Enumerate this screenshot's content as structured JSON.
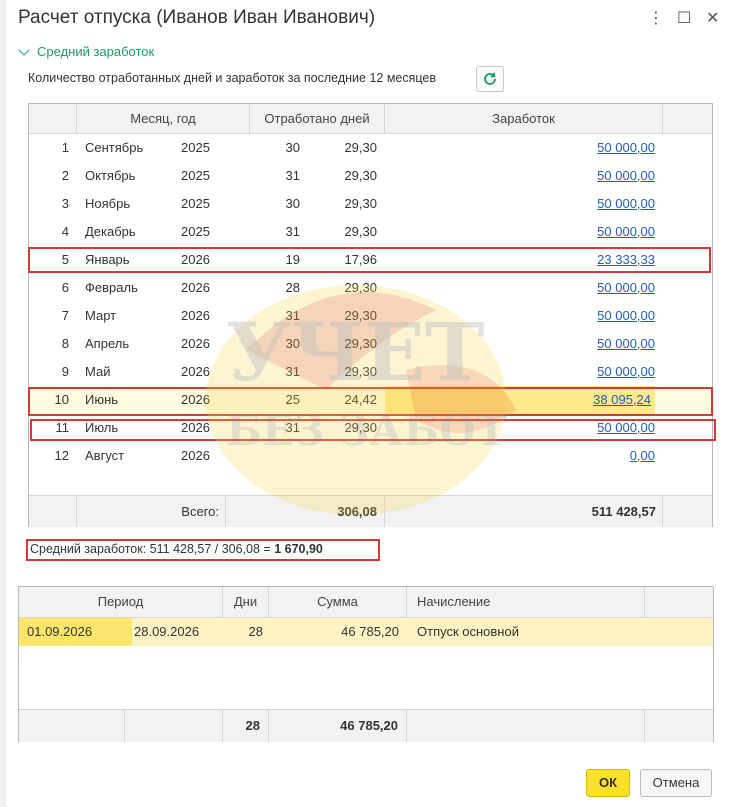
{
  "window": {
    "title": "Расчет отпуска (Иванов Иван Иванович)",
    "controls": {
      "menu": "⋮",
      "maximize": "☐",
      "close": "✕"
    }
  },
  "section": {
    "title": "Средний заработок"
  },
  "earnings": {
    "description": "Количество отработанных дней и заработок за последние 12 месяцев",
    "refresh_icon": "refresh-icon",
    "headers": {
      "month_year": "Месяц, год",
      "worked_days": "Отработано дней",
      "earnings": "Заработок"
    },
    "rows": [
      {
        "n": "1",
        "month": "Сентябрь",
        "year": "2025",
        "days": "30",
        "coef": "29,30",
        "sum": "50 000,00"
      },
      {
        "n": "2",
        "month": "Октябрь",
        "year": "2025",
        "days": "31",
        "coef": "29,30",
        "sum": "50 000,00"
      },
      {
        "n": "3",
        "month": "Ноябрь",
        "year": "2025",
        "days": "30",
        "coef": "29,30",
        "sum": "50 000,00"
      },
      {
        "n": "4",
        "month": "Декабрь",
        "year": "2025",
        "days": "31",
        "coef": "29,30",
        "sum": "50 000,00"
      },
      {
        "n": "5",
        "month": "Январь",
        "year": "2026",
        "days": "19",
        "coef": "17,96",
        "sum": "23 333,33"
      },
      {
        "n": "6",
        "month": "Февраль",
        "year": "2026",
        "days": "28",
        "coef": "29,30",
        "sum": "50 000,00"
      },
      {
        "n": "7",
        "month": "Март",
        "year": "2026",
        "days": "31",
        "coef": "29,30",
        "sum": "50 000,00"
      },
      {
        "n": "8",
        "month": "Апрель",
        "year": "2026",
        "days": "30",
        "coef": "29,30",
        "sum": "50 000,00"
      },
      {
        "n": "9",
        "month": "Май",
        "year": "2026",
        "days": "31",
        "coef": "29,30",
        "sum": "50 000,00"
      },
      {
        "n": "10",
        "month": "Июнь",
        "year": "2026",
        "days": "25",
        "coef": "24,42",
        "sum": "38 095,24"
      },
      {
        "n": "11",
        "month": "Июль",
        "year": "2026",
        "days": "31",
        "coef": "29,30",
        "sum": "50 000,00"
      },
      {
        "n": "12",
        "month": "Август",
        "year": "2026",
        "days": "",
        "coef": "",
        "sum": "0,00"
      }
    ],
    "footer": {
      "label": "Всего:",
      "total_coef": "306,08",
      "total_sum": "511 428,57"
    }
  },
  "average": "Средний заработок: 511 428,57 / 306,08 = 1 670,90",
  "average_bold": "1 670,90",
  "vacation": {
    "headers": {
      "period": "Период",
      "days": "Дни",
      "sum": "Сумма",
      "accrual": "Начисление"
    },
    "rows": [
      {
        "from": "01.09.2026",
        "to": "28.09.2026",
        "days": "28",
        "sum": "46 785,20",
        "accrual": "Отпуск основной"
      }
    ],
    "footer": {
      "days": "28",
      "sum": "46 785,20"
    }
  },
  "buttons": {
    "ok": "ОК",
    "cancel": "Отмена"
  },
  "watermark": {
    "line1": "УЧЕТ",
    "line2": "БЕЗ ЗАБОТ"
  },
  "colors": {
    "accent_green": "#1a9e5f",
    "link_blue": "#1f5fbf",
    "highlight_red": "#d23a3a",
    "ok_yellow": "#fbe12a",
    "row_selected": "#fff3c4"
  }
}
